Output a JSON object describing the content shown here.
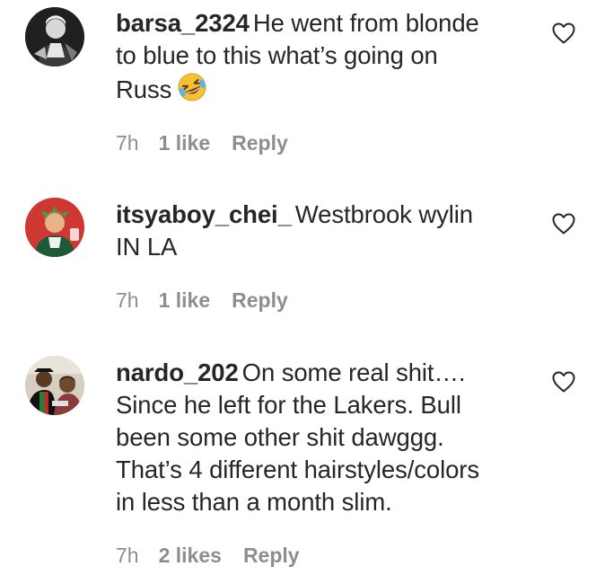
{
  "colors": {
    "text": "#262626",
    "meta": "#8e8e8e",
    "background": "#ffffff"
  },
  "comments": [
    {
      "username": "barsa_2324",
      "line1": "He went from blonde",
      "line2": "to blue to this what’s going on",
      "line3": "Russ",
      "emoji": "rolling-on-floor-laughing-emoji",
      "time": "7h",
      "likes": "1 like",
      "reply": "Reply",
      "like_icon": "heart-outline-icon"
    },
    {
      "username": "itsyaboy_chei_",
      "line1": "Westbrook wylin",
      "line2": "IN LA",
      "time": "7h",
      "likes": "1 like",
      "reply": "Reply",
      "like_icon": "heart-outline-icon"
    },
    {
      "username": "nardo_202",
      "line1": "On some real shit….",
      "line2": "Since he left for the Lakers. Bull",
      "line3": "been some other shit dawggg.",
      "line4": "That’s 4 different hairstyles/colors",
      "line5": "in less than a month slim.",
      "time": "7h",
      "likes": "2 likes",
      "reply": "Reply",
      "like_icon": "heart-outline-icon"
    }
  ]
}
